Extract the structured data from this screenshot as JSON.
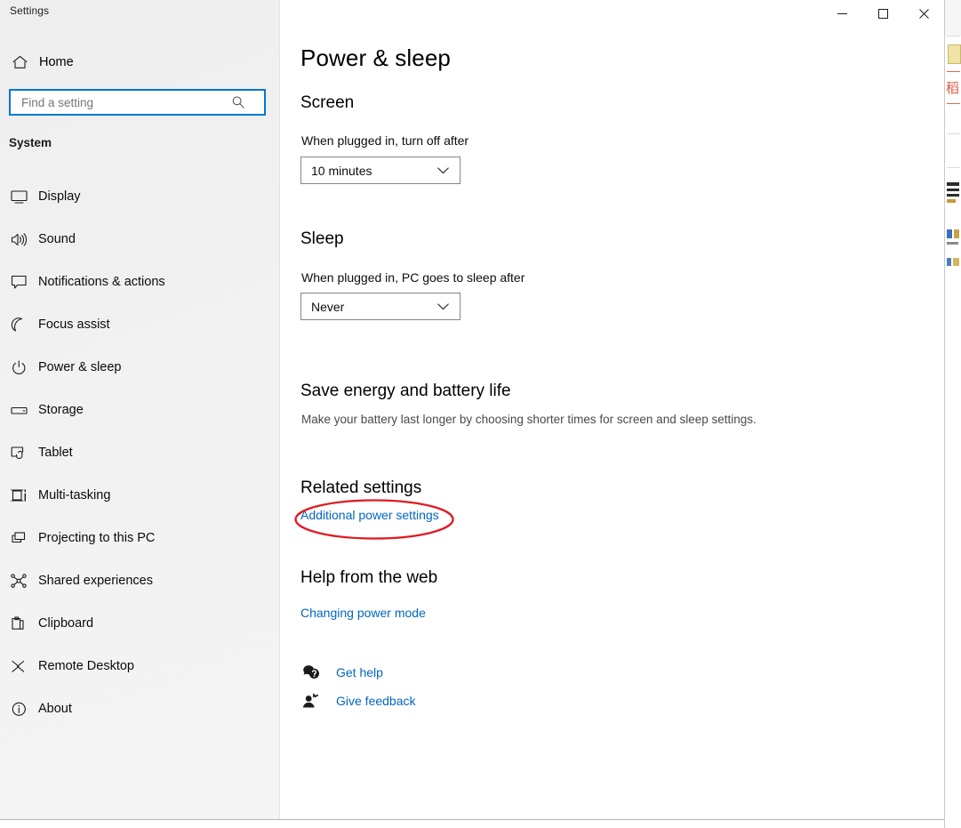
{
  "window": {
    "title": "Settings",
    "controls": {
      "minimize": "Minimize",
      "maximize": "Maximize",
      "close": "Close"
    }
  },
  "sidebar": {
    "home": {
      "label": "Home",
      "icon": "home-icon"
    },
    "search": {
      "placeholder": "Find a setting",
      "value": "",
      "icon": "search-icon"
    },
    "group_label": "System",
    "items": [
      {
        "label": "Display",
        "icon": "monitor-icon",
        "selected": false
      },
      {
        "label": "Sound",
        "icon": "speaker-icon",
        "selected": false
      },
      {
        "label": "Notifications & actions",
        "icon": "notification-icon",
        "selected": false
      },
      {
        "label": "Focus assist",
        "icon": "moon-icon",
        "selected": false
      },
      {
        "label": "Power & sleep",
        "icon": "power-icon",
        "selected": false
      },
      {
        "label": "Storage",
        "icon": "drive-icon",
        "selected": false
      },
      {
        "label": "Tablet",
        "icon": "tablet-icon",
        "selected": false
      },
      {
        "label": "Multi-tasking",
        "icon": "multitasking-icon",
        "selected": false
      },
      {
        "label": "Projecting to this PC",
        "icon": "projecting-icon",
        "selected": false
      },
      {
        "label": "Shared experiences",
        "icon": "share-nodes-icon",
        "selected": false
      },
      {
        "label": "Clipboard",
        "icon": "clipboard-icon",
        "selected": false
      },
      {
        "label": "Remote Desktop",
        "icon": "remote-desktop-icon",
        "selected": false
      },
      {
        "label": "About",
        "icon": "info-icon",
        "selected": false
      }
    ]
  },
  "main": {
    "page_title": "Power & sleep",
    "screen": {
      "heading": "Screen",
      "field_label": "When plugged in, turn off after",
      "dropdown_value": "10 minutes"
    },
    "sleep": {
      "heading": "Sleep",
      "field_label": "When plugged in, PC goes to sleep after",
      "dropdown_value": "Never"
    },
    "save_energy": {
      "heading": "Save energy and battery life",
      "description": "Make your battery last longer by choosing shorter times for screen and sleep settings."
    },
    "related_settings": {
      "heading": "Related settings",
      "link": "Additional power settings"
    },
    "help_from_web": {
      "heading": "Help from the web",
      "link": "Changing power mode"
    },
    "support": [
      {
        "label": "Get help",
        "icon": "get-help-icon"
      },
      {
        "label": "Give feedback",
        "icon": "give-feedback-icon"
      }
    ]
  },
  "annotation": {
    "shape": "ellipse",
    "color": "#e01b24",
    "target": "Additional power settings"
  },
  "colors": {
    "accent": "#0078d7",
    "link": "#0067c0",
    "sidebar_bg": "#f1f1f1",
    "content_bg": "#ffffff",
    "annotation_red": "#e01b24"
  }
}
